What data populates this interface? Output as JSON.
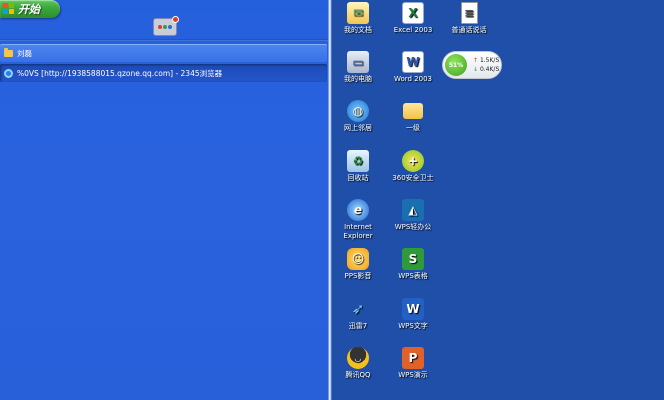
{
  "taskbar": {
    "start_label": "开始",
    "quick_launch_icon": "2345-browser-icon",
    "tasks": [
      {
        "label": "刘磊",
        "icon": "folder-icon"
      },
      {
        "label": "%0ⅤS  [http://1938588015.qzone.qq.com] - 2345浏览器",
        "icon": "browser-icon"
      }
    ]
  },
  "desktop": {
    "icons": [
      {
        "label": "我的文档",
        "icon": "my-documents-icon"
      },
      {
        "label": "Excel 2003",
        "icon": "excel-icon"
      },
      {
        "label": "普通话说话",
        "icon": "document-icon"
      },
      {
        "label": "我的电脑",
        "icon": "my-computer-icon"
      },
      {
        "label": "Word 2003",
        "icon": "word-icon"
      },
      {
        "label": "网上邻居",
        "icon": "network-icon"
      },
      {
        "label": "一级",
        "icon": "folder-icon"
      },
      {
        "label": "回收站",
        "icon": "recycle-bin-icon"
      },
      {
        "label": "360安全卫士",
        "icon": "360-security-icon"
      },
      {
        "label": "Internet\nExplorer",
        "icon": "ie-icon"
      },
      {
        "label": "WPS轻办公",
        "icon": "wps-office-icon"
      },
      {
        "label": "PPS影音",
        "icon": "pps-icon"
      },
      {
        "label": "WPS表格",
        "icon": "wps-spreadsheet-icon"
      },
      {
        "label": "迅雷7",
        "icon": "thunder-icon"
      },
      {
        "label": "WPS文字",
        "icon": "wps-writer-icon"
      },
      {
        "label": "腾讯QQ",
        "icon": "qq-icon"
      },
      {
        "label": "WPS演示",
        "icon": "wps-presentation-icon"
      }
    ]
  },
  "net_widget": {
    "percent": "51%",
    "upload": "1.5K/S",
    "download": "0.4K/S",
    "up_arrow": "↑",
    "down_arrow": "↓"
  }
}
